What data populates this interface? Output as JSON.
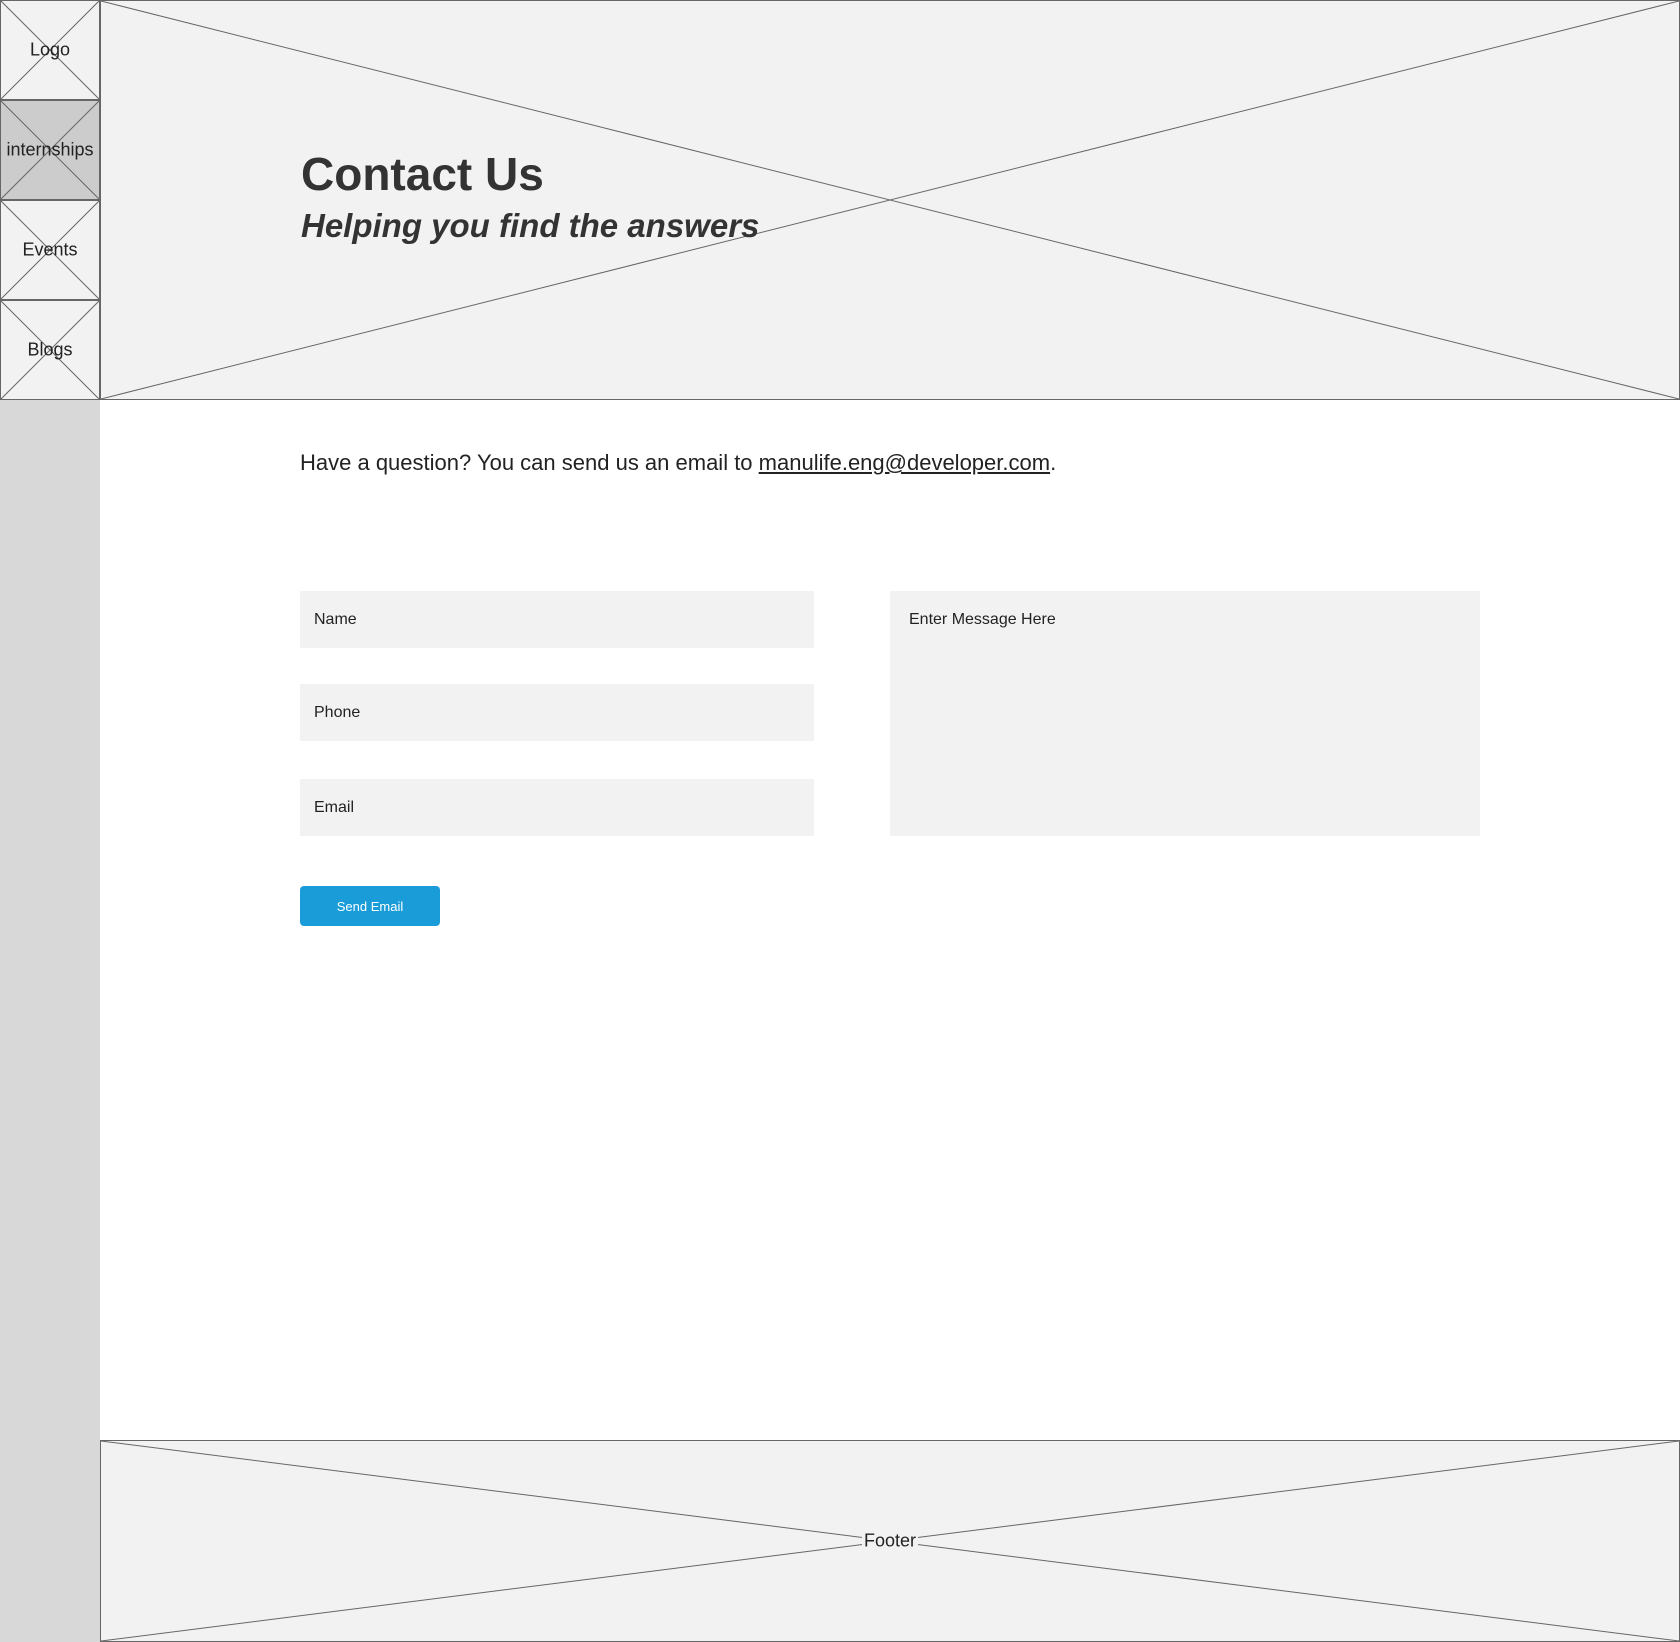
{
  "sidebar": {
    "items": [
      {
        "label": "Logo",
        "selected": false
      },
      {
        "label": "internships",
        "selected": true
      },
      {
        "label": "Events",
        "selected": false
      },
      {
        "label": "Blogs",
        "selected": false
      }
    ]
  },
  "hero": {
    "title": "Contact Us",
    "subtitle": "Helping you find the answers"
  },
  "intro": {
    "text_before": "Have a question? You can send us an email to ",
    "email_link": "manulife.eng@developer.com",
    "text_after": "."
  },
  "form": {
    "name_placeholder": "Name",
    "phone_placeholder": "Phone",
    "email_placeholder": "Email",
    "message_placeholder": "Enter Message Here",
    "send_label": "Send Email"
  },
  "footer": {
    "label": "Footer"
  },
  "colors": {
    "accent": "#1a9cd8",
    "placeholder_fill": "#f2f2f2",
    "sidebar_bg": "#d8d8d8",
    "nav_selected": "#cccccc"
  }
}
